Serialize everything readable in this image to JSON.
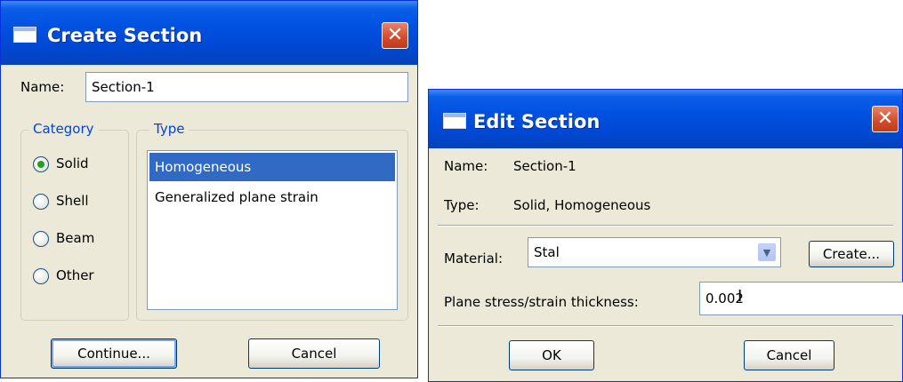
{
  "create_section": {
    "title": "Create Section",
    "close_glyph": "✕",
    "name_label": "Name:",
    "name_value": "Section-1",
    "category": {
      "legend": "Category",
      "options": [
        {
          "label": "Solid",
          "checked": true
        },
        {
          "label": "Shell",
          "checked": false
        },
        {
          "label": "Beam",
          "checked": false
        },
        {
          "label": "Other",
          "checked": false
        }
      ]
    },
    "type": {
      "legend": "Type",
      "items": [
        {
          "label": "Homogeneous",
          "selected": true
        },
        {
          "label": "Generalized plane strain",
          "selected": false
        }
      ]
    },
    "continue_label": "Continue...",
    "cancel_label": "Cancel"
  },
  "edit_section": {
    "title": "Edit Section",
    "close_glyph": "✕",
    "name_label": "Name:",
    "name_value": "Section-1",
    "type_label": "Type:",
    "type_value": "Solid, Homogeneous",
    "material_label": "Material:",
    "material_value": "Stal",
    "create_label": "Create...",
    "thickness_label": "Plane stress/strain thickness:",
    "thickness_value": "0.002",
    "ok_label": "OK",
    "cancel_label": "Cancel"
  },
  "colors": {
    "titlebar": "#0051e0",
    "dialog_bg": "#ece9d8",
    "selection": "#316ac5",
    "group_legend": "#0046d5",
    "close_button": "#d34a2a"
  }
}
